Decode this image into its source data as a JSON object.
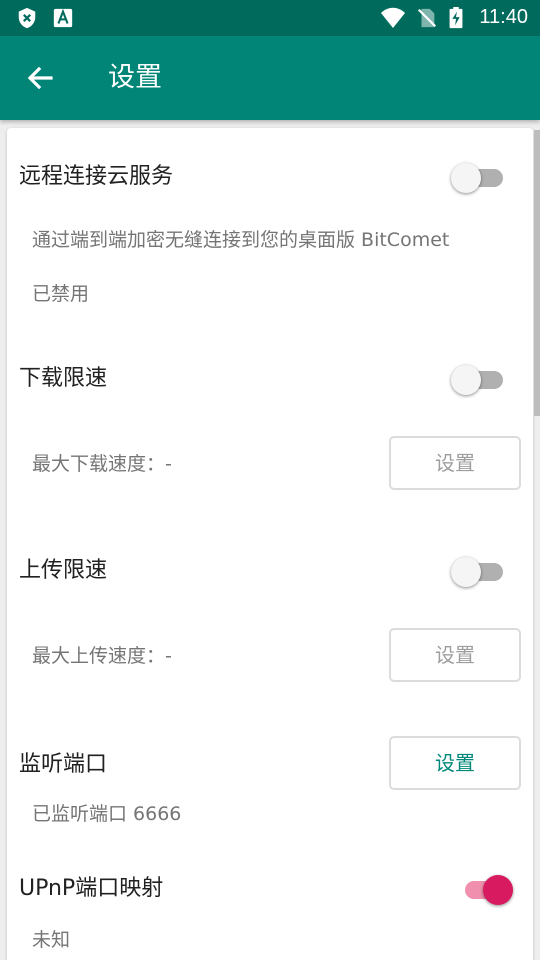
{
  "status_bar": {
    "time": "11:40",
    "icons": [
      "shield-icon",
      "font-a-icon",
      "wifi-icon",
      "no-sim-icon",
      "battery-charging-icon"
    ]
  },
  "app_bar": {
    "back_icon": "arrow-left-icon",
    "title": "设置"
  },
  "settings": {
    "remote": {
      "label": "远程连接云服务",
      "description": "通过端到端加密无缝连接到您的桌面版 BitComet",
      "status": "已禁用",
      "enabled": false
    },
    "download_limit": {
      "label": "下载限速",
      "max_speed": "最大下载速度：-",
      "button": "设置",
      "enabled": false
    },
    "upload_limit": {
      "label": "上传限速",
      "max_speed": "最大上传速度：-",
      "button": "设置",
      "enabled": false
    },
    "listen_port": {
      "label": "监听端口",
      "status": "已监听端口 6666",
      "button": "设置"
    },
    "upnp": {
      "label": "UPnP端口映射",
      "status": "未知",
      "enabled": true
    }
  },
  "colors": {
    "status_bar": "#006b5d",
    "app_bar": "#008577",
    "accent": "#d81b60",
    "button_active_text": "#00897b"
  }
}
